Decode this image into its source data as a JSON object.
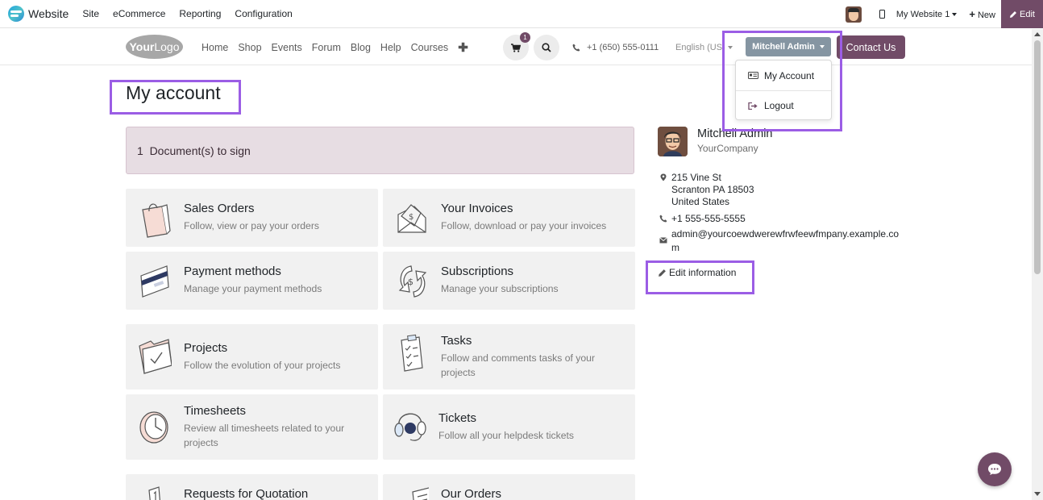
{
  "admin_bar": {
    "title": "Website",
    "menu": [
      "Site",
      "eCommerce",
      "Reporting",
      "Configuration"
    ],
    "site_selector": "My Website 1",
    "new_label": "New",
    "edit_label": "Edit"
  },
  "header": {
    "logo_your": "Your",
    "logo_rest": "Logo",
    "nav": [
      "Home",
      "Shop",
      "Events",
      "Forum",
      "Blog",
      "Help",
      "Courses"
    ],
    "cart_count": "1",
    "phone": "+1 (650) 555-0111",
    "language": "English (US)",
    "user_menu": "Mitchell Admin",
    "contact": "Contact Us"
  },
  "dropdown": {
    "items": [
      "My Account",
      "Logout"
    ]
  },
  "page": {
    "title": "My account",
    "sign_alert": "1  Document(s) to sign"
  },
  "cards": [
    {
      "title": "Sales Orders",
      "subtitle": "Follow, view or pay your orders"
    },
    {
      "title": "Your Invoices",
      "subtitle": "Follow, download or pay your invoices"
    },
    {
      "title": "Payment methods",
      "subtitle": "Manage your payment methods"
    },
    {
      "title": "Subscriptions",
      "subtitle": "Manage your subscriptions"
    },
    {
      "title": "Projects",
      "subtitle": "Follow the evolution of your projects"
    },
    {
      "title": "Tasks",
      "subtitle": "Follow and comments tasks of your projects"
    },
    {
      "title": "Timesheets",
      "subtitle": "Review all timesheets related to your projects"
    },
    {
      "title": "Tickets",
      "subtitle": "Follow all your helpdesk tickets"
    },
    {
      "title": "Requests for Quotation",
      "subtitle": ""
    },
    {
      "title": "Our Orders",
      "subtitle": ""
    }
  ],
  "profile": {
    "name": "Mitchell Admin",
    "company": "YourCompany",
    "address_line1": "215 Vine St",
    "address_line2": "Scranton PA 18503",
    "address_line3": "United States",
    "phone": "+1 555-555-5555",
    "email_line1": "admin@yourcoewdwerewfrwfeewfmpany.example.co",
    "email_line2": "m",
    "edit_label": "Edit information"
  },
  "colors": {
    "brand": "#714b67",
    "highlight": "#9b5de5",
    "user_button": "#8595a2",
    "card_bg": "#f1f1f1",
    "alert_bg": "#e7dde3"
  },
  "icons": {
    "admin_logo": "website-logo-icon",
    "cart": "cart-icon",
    "search": "search-icon",
    "phone": "phone-icon",
    "chat": "chat-icon"
  }
}
